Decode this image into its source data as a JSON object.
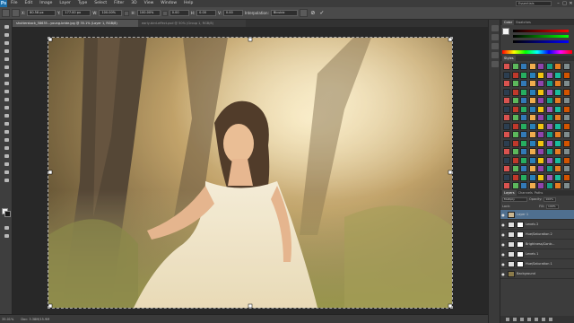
{
  "menubar": {
    "logo": "Ps",
    "items": [
      "File",
      "Edit",
      "Image",
      "Layer",
      "Type",
      "Select",
      "Filter",
      "3D",
      "View",
      "Window",
      "Help"
    ],
    "workspace": "Essentials",
    "window_buttons": [
      "–",
      "□",
      "✕"
    ]
  },
  "options": {
    "x": "80.58 px",
    "y": "177.00 px",
    "w": "100.00%",
    "h": "100.00%",
    "angle": "0.00",
    "h_skew": "0.00",
    "v_skew": "0.00",
    "interpolation_label": "Interpolation:",
    "interpolation": "Bicubic",
    "cancel": "⊘",
    "commit": "✓"
  },
  "tabs": [
    {
      "label": "shutterstock_58635...young-bride.jpg @ 35.1% (Layer 1, RGB/8)",
      "active": true
    },
    {
      "label": "early-bird-effect.psd @ 50% (Group 1, RGB/8)",
      "active": false
    }
  ],
  "status": {
    "zoom": "35.01%",
    "doc": "Doc: 3.38M/15.9M"
  },
  "panels": {
    "color_tabs": [
      "Color",
      "Swatches"
    ],
    "styles_tabs": [
      "Styles"
    ],
    "layers_tabs": [
      "Layers",
      "Channels",
      "Paths"
    ],
    "blend_mode": "Multiply",
    "opacity_label": "Opacity:",
    "opacity": "100%",
    "lock_label": "Lock:",
    "fill_label": "Fill:",
    "fill": "100%"
  },
  "layers": [
    {
      "name": "Layer 1",
      "thumb": "#c9b590",
      "mask": false,
      "selected": true
    },
    {
      "name": "Levels 2",
      "thumb": "#dddddd",
      "mask": true,
      "selected": false
    },
    {
      "name": "Hue/Saturation 2",
      "thumb": "#dddddd",
      "mask": true,
      "selected": false
    },
    {
      "name": "Brightness/Contr...",
      "thumb": "#dddddd",
      "mask": true,
      "selected": false
    },
    {
      "name": "Levels 1",
      "thumb": "#dddddd",
      "mask": true,
      "selected": false
    },
    {
      "name": "Hue/Saturation 1",
      "thumb": "#dddddd",
      "mask": true,
      "selected": false
    },
    {
      "name": "Background",
      "thumb": "#8a7a4a",
      "mask": false,
      "selected": false
    }
  ],
  "colors": {
    "accent": "#1e6fa8",
    "selected_layer": "#4f6f8f"
  }
}
